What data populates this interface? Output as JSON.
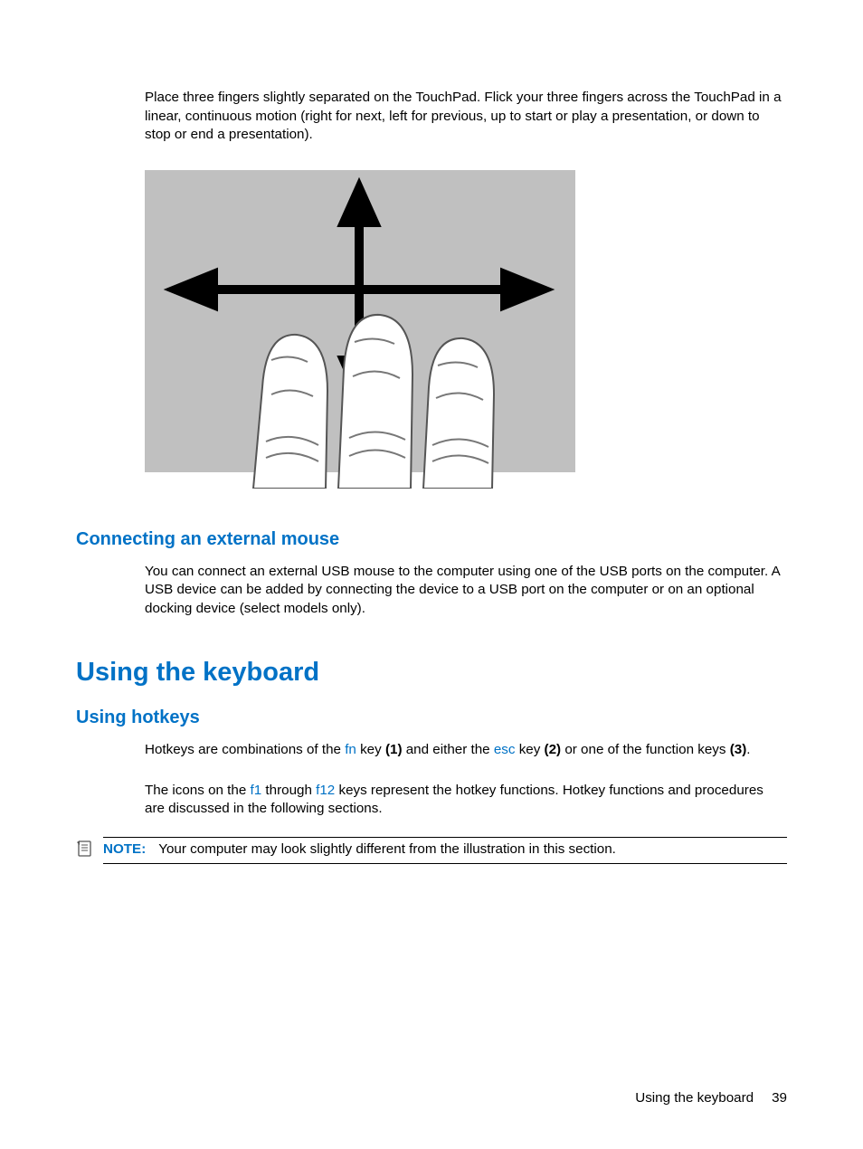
{
  "intro_paragraph": "Place three fingers slightly separated on the TouchPad. Flick your three fingers across the TouchPad in a linear, continuous motion (right for next, left for previous, up to start or play a presentation, or down to stop or end a presentation).",
  "section_mouse": {
    "heading": "Connecting an external mouse",
    "body": "You can connect an external USB mouse to the computer using one of the USB ports on the computer. A USB device can be added by connecting the device to a USB port on the computer or on an optional docking device (select models only)."
  },
  "section_keyboard": {
    "heading": "Using the keyboard"
  },
  "section_hotkeys": {
    "heading": "Using hotkeys",
    "p1_a": "Hotkeys are combinations of the ",
    "p1_fn": "fn",
    "p1_b": " key ",
    "p1_b1": "(1)",
    "p1_c": " and either the ",
    "p1_esc": "esc",
    "p1_d": " key ",
    "p1_d1": "(2)",
    "p1_e": " or one of the function keys ",
    "p1_e1": "(3)",
    "p1_f": ".",
    "p2_a": "The icons on the ",
    "p2_f1": "f1",
    "p2_b": " through ",
    "p2_f12": "f12",
    "p2_c": " keys represent the hotkey functions. Hotkey functions and procedures are discussed in the following sections."
  },
  "note": {
    "label": "NOTE:",
    "text": "Your computer may look slightly different from the illustration in this section."
  },
  "footer": {
    "section": "Using the keyboard",
    "page": "39"
  }
}
